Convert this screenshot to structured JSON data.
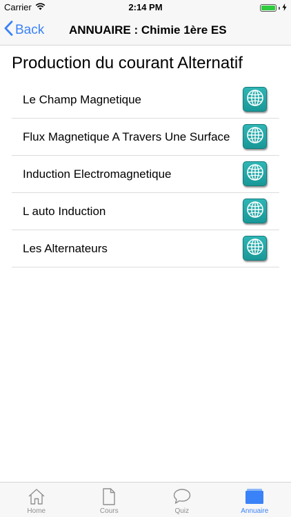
{
  "status_bar": {
    "carrier": "Carrier",
    "time": "2:14 PM",
    "battery_level": 1.0
  },
  "nav": {
    "back_label": "Back",
    "title": "ANNUAIRE : Chimie 1ère ES"
  },
  "section": {
    "title": "Production du courant Alternatif"
  },
  "items": [
    {
      "label": "Le Champ Magnetique",
      "icon": "globe-icon"
    },
    {
      "label": "Flux Magnetique A Travers Une Surface",
      "icon": "globe-icon"
    },
    {
      "label": "Induction Electromagnetique",
      "icon": "globe-icon"
    },
    {
      "label": "L auto Induction",
      "icon": "globe-icon"
    },
    {
      "label": "Les Alternateurs",
      "icon": "globe-icon"
    }
  ],
  "tabs": [
    {
      "label": "Home",
      "icon": "home-icon",
      "active": false
    },
    {
      "label": "Cours",
      "icon": "document-icon",
      "active": false
    },
    {
      "label": "Quiz",
      "icon": "speech-bubble-icon",
      "active": false
    },
    {
      "label": "Annuaire",
      "icon": "book-icon",
      "active": true
    }
  ],
  "colors": {
    "accent": "#3a82f7",
    "globe_button": "#1fa6a6",
    "battery": "#2fcc3f",
    "inactive_tab": "#8e8e8e"
  }
}
